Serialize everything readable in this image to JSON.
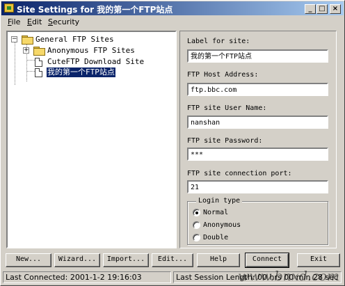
{
  "window": {
    "title": "Site Settings for 我的第一个FTP站点",
    "buttons": {
      "minimize": "_",
      "maximize": "□",
      "close": "×"
    }
  },
  "menu": [
    {
      "label": "File",
      "accel": "F"
    },
    {
      "label": "Edit",
      "accel": "E"
    },
    {
      "label": "Security",
      "accel": "S"
    }
  ],
  "tree": {
    "root": {
      "label": "General FTP Sites",
      "expander": "−"
    },
    "children": [
      {
        "label": "Anonymous FTP Sites",
        "expander": "+",
        "icon": "folder-icon"
      },
      {
        "label": "CuteFTP Download Site",
        "icon": "document-icon"
      },
      {
        "label": "我的第一个FTP站点",
        "icon": "document-icon",
        "selected": true
      }
    ]
  },
  "form": {
    "site_label": {
      "label": "Label for site:",
      "value": "我的第一个FTP站点"
    },
    "host": {
      "label": "FTP Host Address:",
      "value": "ftp.bbc.com"
    },
    "username": {
      "label": "FTP site User Name:",
      "value": "nanshan"
    },
    "password": {
      "label": "FTP site Password:",
      "value": "***"
    },
    "port": {
      "label": "FTP site connection port:",
      "value": "21"
    },
    "login_type": {
      "legend": "Login type",
      "options": [
        {
          "label": "Normal",
          "checked": true
        },
        {
          "label": "Anonymous",
          "checked": false
        },
        {
          "label": "Double",
          "checked": false
        }
      ]
    }
  },
  "buttons": {
    "new": "New...",
    "wizard": "Wizard...",
    "import": "Import...",
    "edit": "Edit...",
    "help": "Help",
    "connect": "Connect",
    "exit": "Exit"
  },
  "status": {
    "last_connected": "Last Connected: 2001-1-2 19:16:03",
    "last_session": "Last Session Length: 00 hrs 00 min 28 sec"
  },
  "watermark": "www.bnxd.com",
  "colors": {
    "titlebar_start": "#0a246a",
    "titlebar_end": "#a6caf0",
    "face": "#d4d0c8",
    "selection": "#0a246a"
  }
}
